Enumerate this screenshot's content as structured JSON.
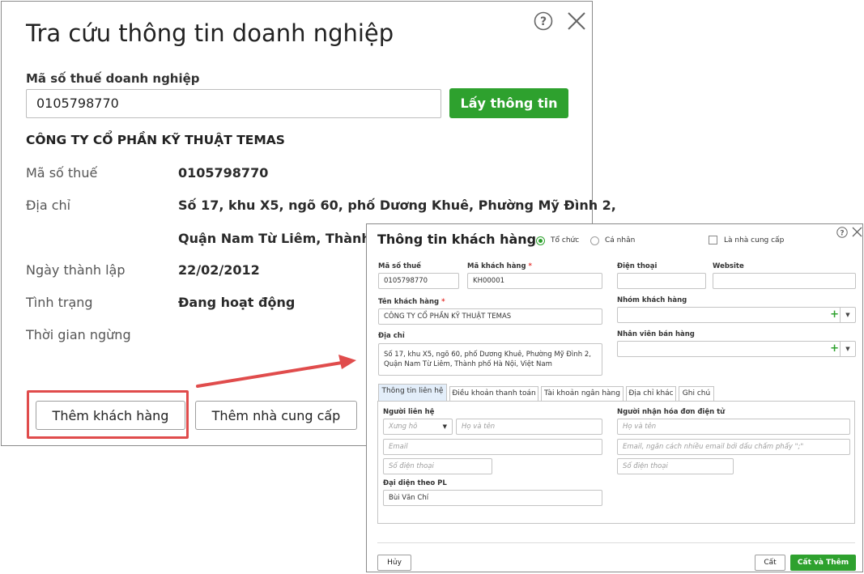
{
  "lookup": {
    "title": "Tra cứu thông tin doanh nghiệp",
    "tax_label": "Mã số thuế doanh nghiệp",
    "tax_value": "0105798770",
    "get_button": "Lấy thông tin",
    "company_name": "CÔNG TY CỔ PHẦN KỸ THUẬT TEMAS",
    "fields": {
      "tax_label": "Mã số thuế",
      "tax_value": "0105798770",
      "address_label": "Địa chỉ",
      "address_line1": "Số 17, khu X5, ngõ 60, phố Dương Khuê, Phường Mỹ Đình 2,",
      "address_line2": "Quận Nam Từ Liêm, Thành phố",
      "founded_label": "Ngày thành lập",
      "founded_value": "22/02/2012",
      "status_label": "Tình trạng",
      "status_value": "Đang hoạt động",
      "stopped_label": "Thời gian ngừng"
    },
    "add_customer_button": "Thêm khách hàng",
    "add_supplier_button": "Thêm nhà cung cấp",
    "icons": [
      "help-icon",
      "close-icon"
    ]
  },
  "customer": {
    "title": "Thông tin khách hàng",
    "type_options": {
      "org": "Tổ chức",
      "person": "Cá nhân",
      "org_selected": true
    },
    "supplier_checkbox": "Là nhà cung cấp",
    "tax_code": {
      "label": "Mã số thuế",
      "value": "0105798770"
    },
    "customer_code": {
      "label": "Mã khách hàng",
      "required": "*",
      "value": "KH00001"
    },
    "phone": {
      "label": "Điện thoại",
      "value": ""
    },
    "website": {
      "label": "Website",
      "value": ""
    },
    "name": {
      "label": "Tên khách hàng",
      "required": "*",
      "value": "CÔNG TY CỔ PHẦN KỸ THUẬT TEMAS"
    },
    "customer_group": {
      "label": "Nhóm khách hàng",
      "value": ""
    },
    "address": {
      "label": "Địa chỉ",
      "line1": "Số 17, khu X5, ngõ 60, phố Dương Khuê, Phường Mỹ Đình 2,",
      "line2": "Quận Nam Từ Liêm, Thành phố Hà Nội, Việt Nam"
    },
    "sales_staff": {
      "label": "Nhân viên bán hàng",
      "value": ""
    },
    "tabs": [
      "Thông tin liên hệ",
      "Điều khoản thanh toán",
      "Tài khoản ngân hàng",
      "Địa chỉ khác",
      "Ghi chú"
    ],
    "active_tab": "Thông tin liên hệ",
    "contact": {
      "label": "Người liên hệ",
      "salutation_placeholder": "Xưng hô",
      "fullname_placeholder": "Họ và tên",
      "email_placeholder": "Email",
      "phone_placeholder": "Số điện thoại"
    },
    "einvoice": {
      "label": "Người nhận hóa đơn điện tử",
      "fullname_placeholder": "Họ và tên",
      "email_placeholder": "Email, ngăn cách nhiều email bởi dấu chấm phẩy \";\"",
      "phone_placeholder": "Số điện thoại"
    },
    "legal_rep": {
      "label": "Đại diện theo PL",
      "value": "Bùi Văn Chí"
    },
    "buttons": {
      "cancel": "Hủy",
      "save": "Cất",
      "save_add": "Cất và Thêm"
    },
    "icons": [
      "help-icon",
      "close-icon",
      "plus-icon",
      "chevron-down-icon"
    ]
  },
  "colors": {
    "accent_green": "#2ea12e",
    "highlight_red": "#e04c4c",
    "arrow_red": "#e04c4c"
  }
}
